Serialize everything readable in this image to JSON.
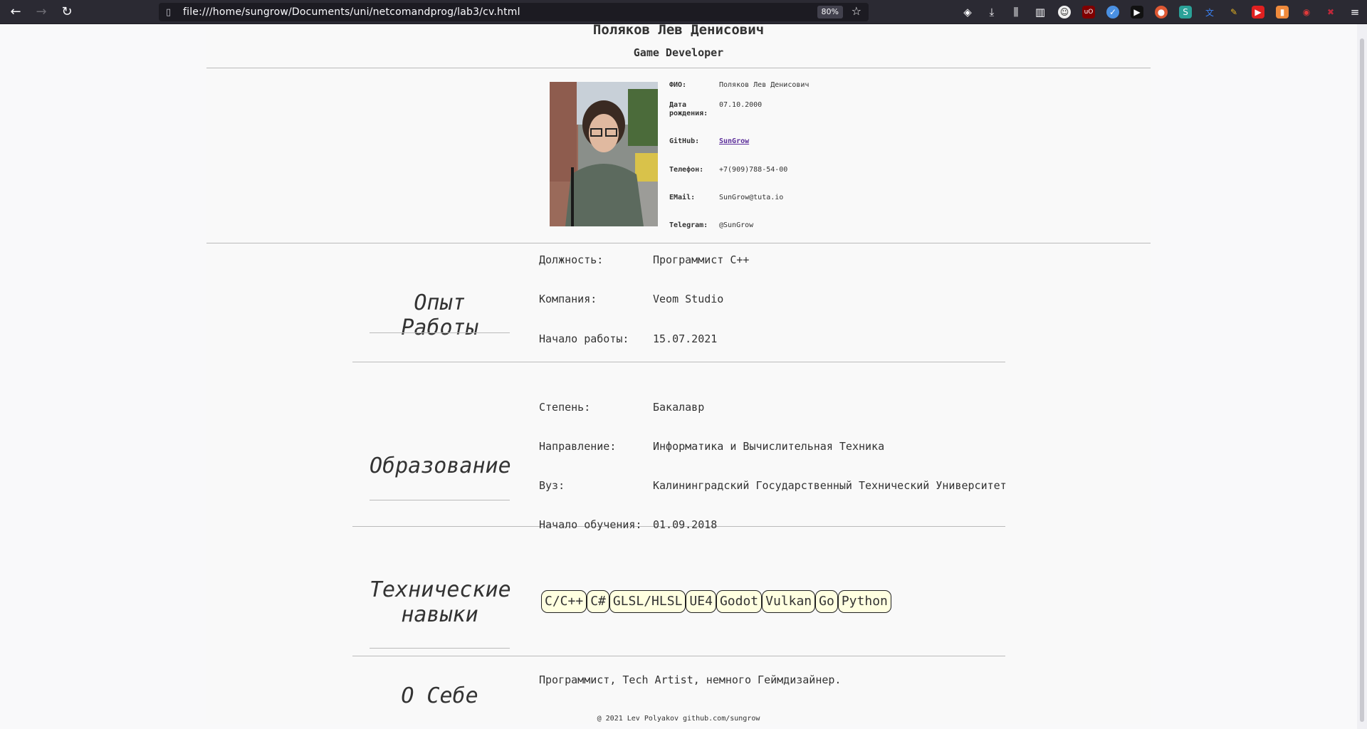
{
  "browser": {
    "url": "file:///home/sungrow/Documents/uni/netcomandprog/lab3/cv.html",
    "zoom": "80%"
  },
  "header": {
    "name": "Поляков Лев Денисович",
    "role": "Game Developer"
  },
  "profile": {
    "rows": [
      {
        "label": "ФИО:",
        "value": "Поляков Лев Денисович"
      },
      {
        "label": "Дата рождения:",
        "value": "07.10.2000"
      },
      {
        "label": "GitHub:",
        "value": "SunGrow"
      },
      {
        "label": "Телефон:",
        "value": "+7(909)788-54-00"
      },
      {
        "label": "EMail:",
        "value": "SunGrow@tuta.io"
      },
      {
        "label": "Telegram:",
        "value": "@SunGrow"
      }
    ]
  },
  "experience": {
    "title": "Опыт Работы",
    "rows": [
      {
        "label": "Должность:",
        "value": "Программист С++"
      },
      {
        "label": "Компания:",
        "value": "Veom Studio"
      },
      {
        "label": "Начало работы:",
        "value": "15.07.2021"
      }
    ]
  },
  "education": {
    "title": "Образование",
    "rows": [
      {
        "label": "Степень:",
        "value": "Бакалавр"
      },
      {
        "label": "Направление:",
        "value": "Информатика и Вычислительная Техника"
      },
      {
        "label": "Вуз:",
        "value": "Калининградский Государственный Технический Университет"
      },
      {
        "label": "Начало обучения:",
        "value": "01.09.2018"
      }
    ]
  },
  "skills": {
    "title": "Технические навыки",
    "items": [
      "C/C++",
      "C#",
      "GLSL/HLSL",
      "UE4",
      "Godot",
      "Vulkan",
      "Go",
      "Python"
    ]
  },
  "about": {
    "title": "О Себе",
    "text": "Программист, Tech Artist, немного Геймдизайнер."
  },
  "footer": {
    "text": "@ 2021 Lev Polyakov github.com/sungrow"
  }
}
